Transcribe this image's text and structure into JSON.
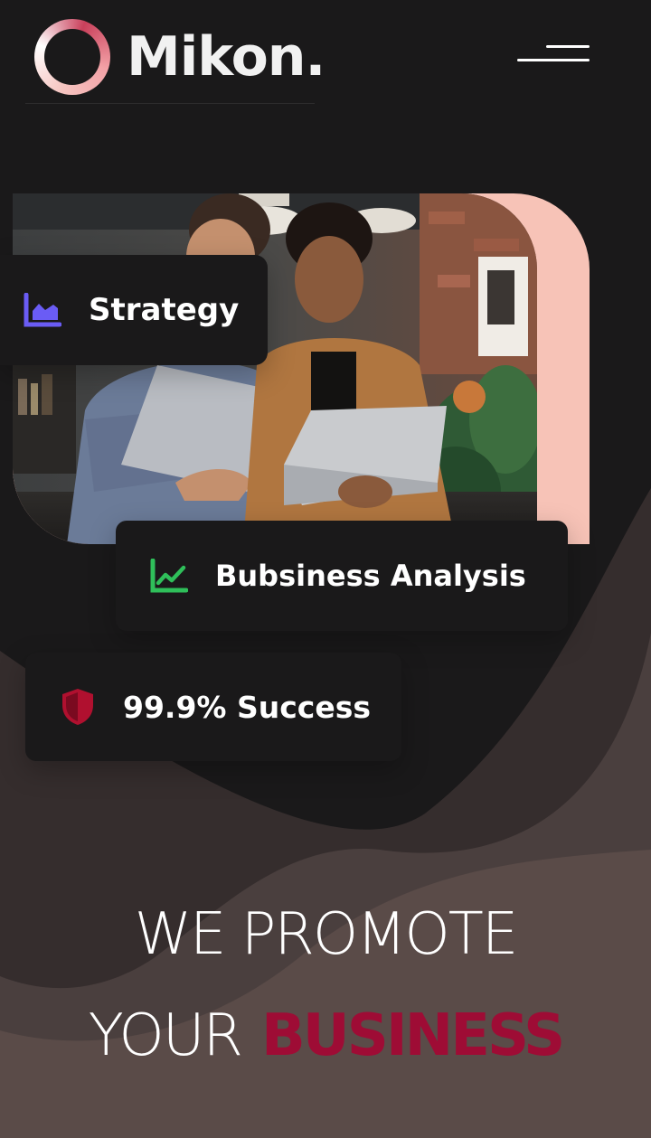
{
  "header": {
    "logo_text": "Mikon.",
    "menu_icon": "hamburger-menu-icon"
  },
  "hero": {
    "image_alt": "Two colleagues holding laptops in an office",
    "accent_color": "#f7c3b7"
  },
  "features": [
    {
      "label": "Strategy",
      "icon": "area-chart-icon",
      "icon_color": "#6a5cf5"
    },
    {
      "label": "Bubsiness Analysis",
      "icon": "line-chart-icon",
      "icon_color": "#2fbf5a"
    },
    {
      "label": "99.9% Success",
      "icon": "shield-icon",
      "icon_color": "#b0102f"
    }
  ],
  "headline": {
    "line1": "WE PROMOTE",
    "line2_prefix": "YOUR",
    "line2_accent": "BUSINESS",
    "accent_color": "#9e0c35"
  }
}
